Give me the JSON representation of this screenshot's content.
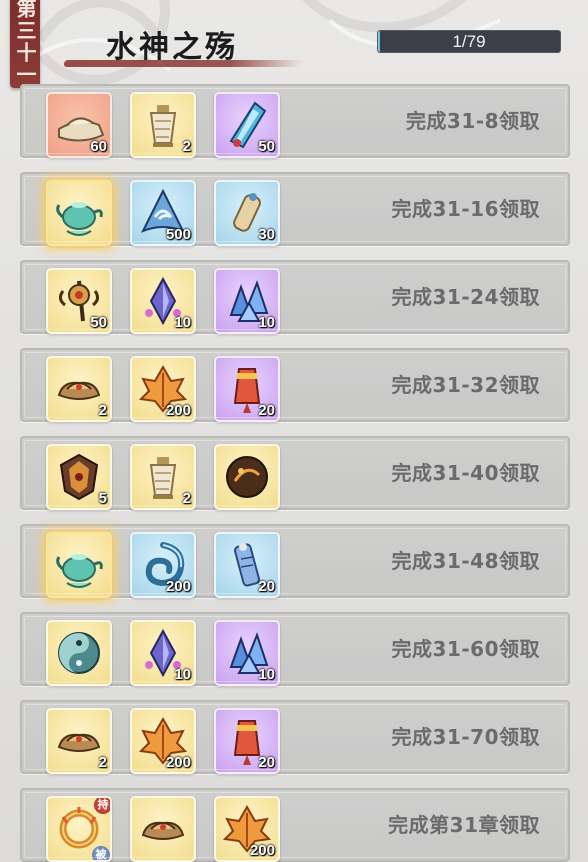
{
  "header": {
    "chapter_tab": "第三十一章",
    "title": "水神之殇",
    "progress_text": "1/79",
    "progress_fraction": 0.0127
  },
  "rows": [
    {
      "label": "完成31-8领取",
      "items": [
        {
          "icon": "silver-ingot-icon",
          "quality": "orange",
          "count": "60"
        },
        {
          "icon": "scroll-stand-icon",
          "quality": "yellow",
          "count": "2"
        },
        {
          "icon": "crystal-shard-icon",
          "quality": "purple",
          "count": "50"
        }
      ]
    },
    {
      "label": "完成31-16领取",
      "items": [
        {
          "icon": "jade-teapot-icon",
          "quality": "yellow",
          "count": "",
          "glow": true
        },
        {
          "icon": "blue-wave-talisman-icon",
          "quality": "blue",
          "count": "500"
        },
        {
          "icon": "scroll-tube-icon",
          "quality": "blue",
          "count": "30"
        }
      ]
    },
    {
      "label": "完成31-24领取",
      "items": [
        {
          "icon": "ornate-axe-icon",
          "quality": "yellow",
          "count": "50"
        },
        {
          "icon": "flame-crystal-icon",
          "quality": "yellow",
          "count": "10"
        },
        {
          "icon": "crystal-cluster-icon",
          "quality": "purple",
          "count": "10"
        }
      ]
    },
    {
      "label": "完成31-32领取",
      "items": [
        {
          "icon": "cloud-hat-icon",
          "quality": "yellow",
          "count": "2"
        },
        {
          "icon": "autumn-leaf-icon",
          "quality": "yellow",
          "count": "200"
        },
        {
          "icon": "red-pouch-icon",
          "quality": "purple",
          "count": "20"
        }
      ]
    },
    {
      "label": "完成31-40领取",
      "items": [
        {
          "icon": "demon-shield-icon",
          "quality": "yellow",
          "count": "5"
        },
        {
          "icon": "scroll-stand-icon",
          "quality": "yellow",
          "count": "2"
        },
        {
          "icon": "dark-orb-icon",
          "quality": "yellow",
          "count": ""
        }
      ]
    },
    {
      "label": "完成31-48领取",
      "items": [
        {
          "icon": "jade-teapot-icon",
          "quality": "yellow",
          "count": "",
          "glow": true
        },
        {
          "icon": "water-swirl-icon",
          "quality": "blue",
          "count": "200"
        },
        {
          "icon": "blue-scroll-icon",
          "quality": "blue",
          "count": "20"
        }
      ]
    },
    {
      "label": "完成31-60领取",
      "items": [
        {
          "icon": "yin-yang-token-icon",
          "quality": "yellow",
          "count": ""
        },
        {
          "icon": "flame-crystal-icon",
          "quality": "yellow",
          "count": "10"
        },
        {
          "icon": "crystal-cluster-icon",
          "quality": "purple",
          "count": "10"
        }
      ]
    },
    {
      "label": "完成31-70领取",
      "items": [
        {
          "icon": "cloud-hat-icon",
          "quality": "yellow",
          "count": "2"
        },
        {
          "icon": "autumn-leaf-icon",
          "quality": "yellow",
          "count": "200"
        },
        {
          "icon": "red-pouch-icon",
          "quality": "purple",
          "count": "20"
        }
      ]
    },
    {
      "label": "完成第31章领取",
      "items": [
        {
          "icon": "flame-ring-icon",
          "quality": "yellow",
          "count": "",
          "badge_top": "持",
          "badge_bottom": "被"
        },
        {
          "icon": "cloud-hat-icon",
          "quality": "yellow",
          "count": ""
        },
        {
          "icon": "autumn-leaf-icon",
          "quality": "yellow",
          "count": "200"
        }
      ]
    }
  ]
}
